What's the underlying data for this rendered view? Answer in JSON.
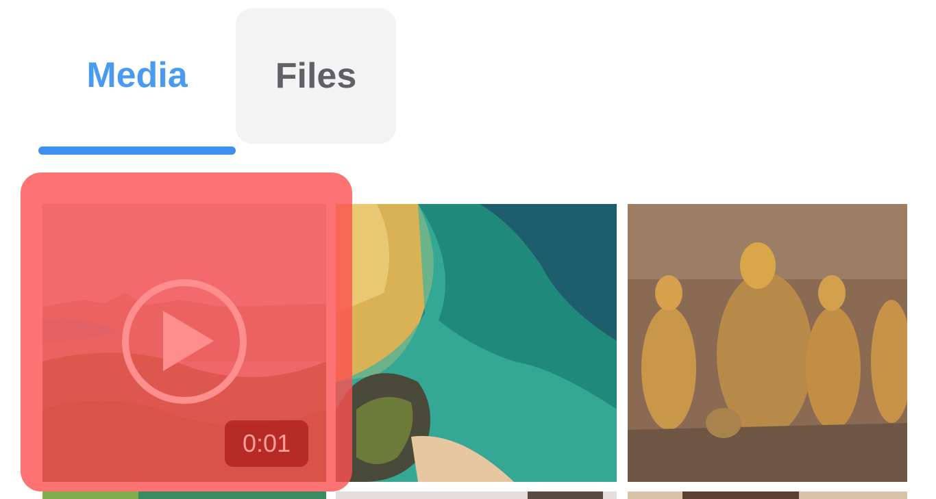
{
  "tabs": {
    "media_label": "Media",
    "files_label": "Files",
    "active": "Media",
    "active_color": "#3b8ff0"
  },
  "media_grid": {
    "items": [
      {
        "kind": "video",
        "duration": "0:01",
        "icon": "play-icon",
        "subject": "coastal city view"
      },
      {
        "kind": "image",
        "subject": "aerial turquoise sea and coastline"
      },
      {
        "kind": "image",
        "subject": "golden buddha relief sculpture"
      },
      {
        "kind": "image",
        "subject": "partially visible"
      },
      {
        "kind": "image",
        "subject": "partially visible"
      },
      {
        "kind": "image",
        "subject": "partially visible"
      }
    ]
  },
  "highlight_color": "#fd5050"
}
